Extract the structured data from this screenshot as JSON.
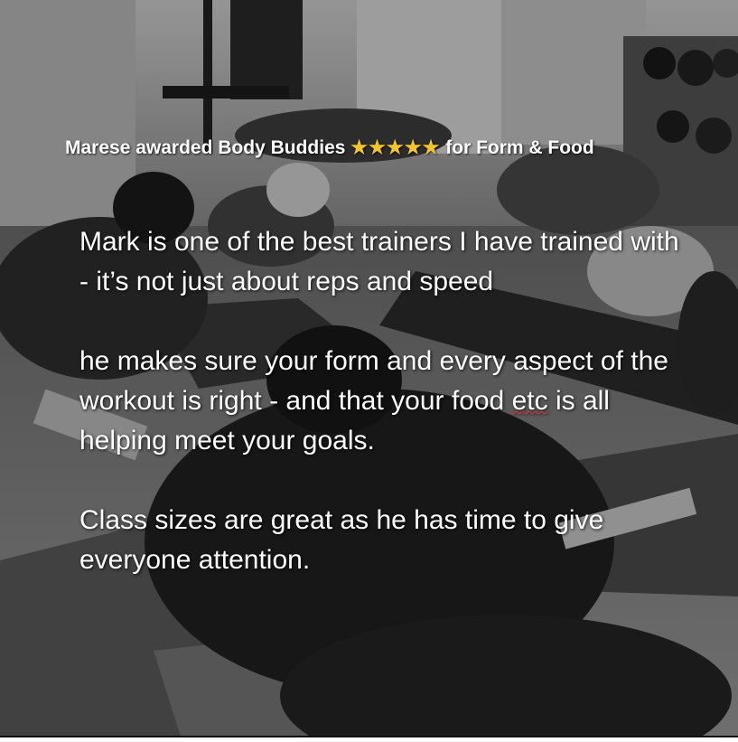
{
  "headline": {
    "prefix": "Marese awarded Body Buddies ",
    "stars": "★★★★★",
    "suffix": " for Form & Food",
    "star_color": "#f4c430"
  },
  "review": {
    "para1": "Mark is one of the best trainers I have trained with - it’s not just about reps and speed",
    "para2_before": "he makes sure your form and every aspect of the workout is right - and that your food ",
    "para2_etc": "etc",
    "para2_after": " is all helping meet your goals.",
    "para3": "Class sizes are great as he has time to give everyone attention."
  },
  "photo": {
    "description_icon": "gym-class-photo",
    "tone": "#7a7a7a"
  }
}
